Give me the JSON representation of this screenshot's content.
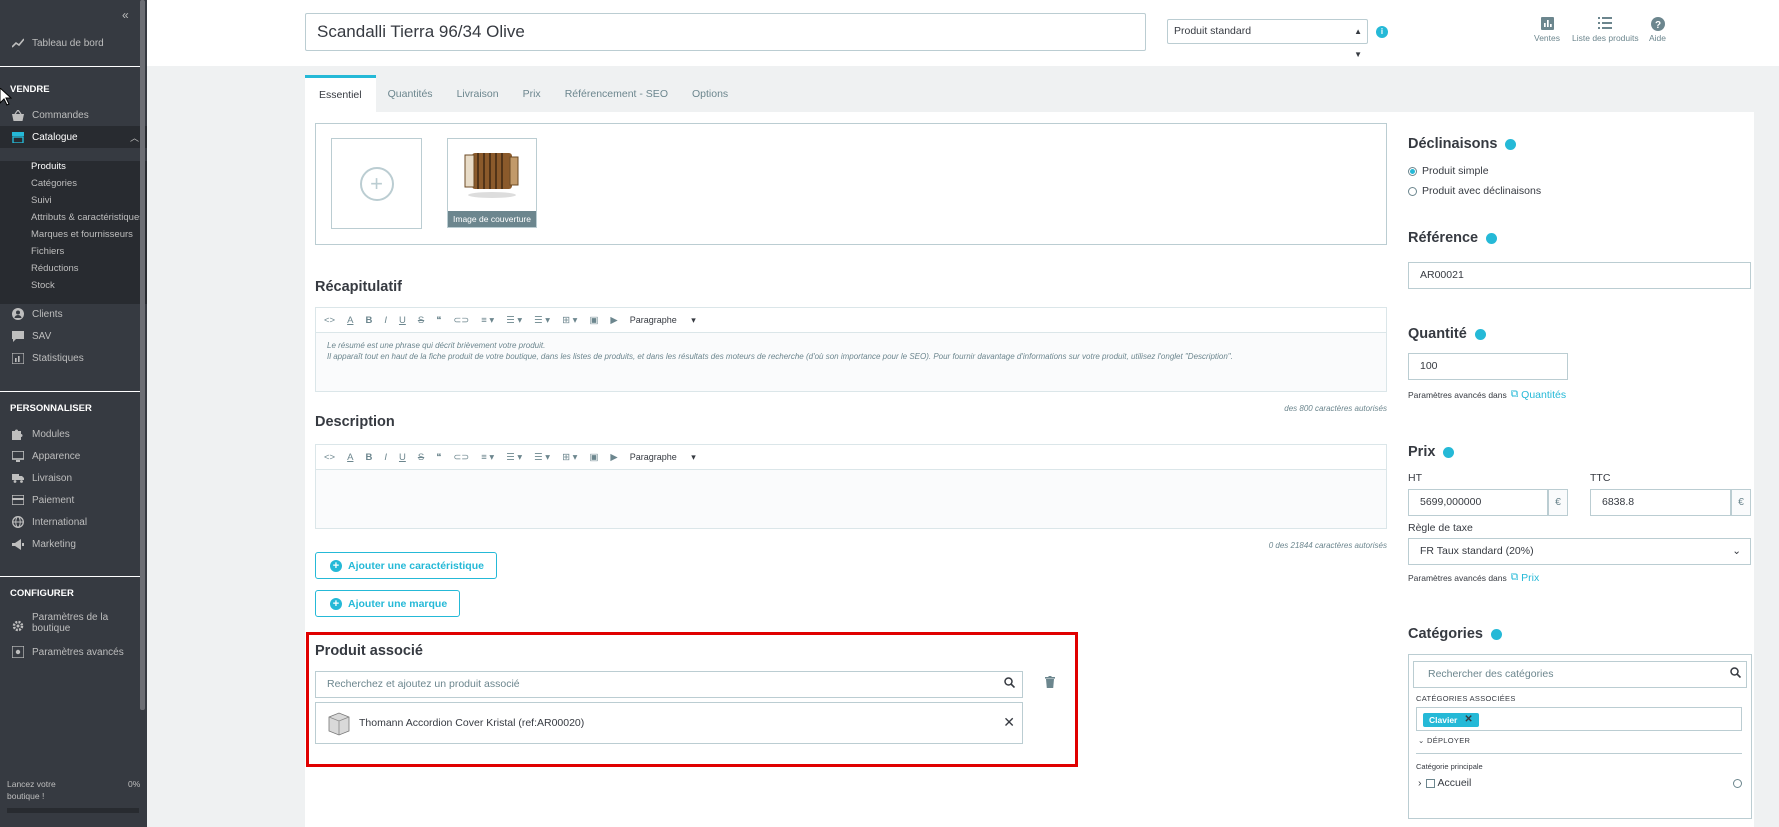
{
  "sidebar": {
    "dashboard": "Tableau de bord",
    "sections": {
      "sell": "VENDRE",
      "customize": "PERSONNALISER",
      "configure": "CONFIGURER"
    },
    "sell_items": {
      "orders": "Commandes",
      "catalog": "Catalogue",
      "customers": "Clients",
      "service": "SAV",
      "stats": "Statistiques"
    },
    "catalog_sub": [
      "Produits",
      "Catégories",
      "Suivi",
      "Attributs & caractéristiques",
      "Marques et fournisseurs",
      "Fichiers",
      "Réductions",
      "Stock"
    ],
    "customize_items": [
      "Modules",
      "Apparence",
      "Livraison",
      "Paiement",
      "International",
      "Marketing"
    ],
    "configure_items": [
      "Paramètres de la boutique",
      "Paramètres avancés"
    ],
    "footer": {
      "line1": "Lancez votre",
      "line2": "boutique !",
      "percent": "0%",
      "progress": 0
    }
  },
  "header": {
    "product_name": "Scandalli Tierra 96/34 Olive",
    "product_type": "Produit standard",
    "actions": {
      "sales": "Ventes",
      "product_list": "Liste des produits",
      "help": "Aide"
    }
  },
  "tabs": [
    "Essentiel",
    "Quantités",
    "Livraison",
    "Prix",
    "Référencement - SEO",
    "Options"
  ],
  "images": {
    "cover_label": "Image de couverture"
  },
  "summary": {
    "title": "Récapitulatif",
    "format_label": "Paragraphe",
    "placeholder_line1": "Le résumé est une phrase qui décrit brièvement votre produit.",
    "placeholder_line2": "Il apparaît tout en haut de la fiche produit de votre boutique, dans les listes de produits, et dans les résultats des moteurs de recherche (d'où son importance pour le SEO). Pour fournir davantage d'informations sur votre produit, utilisez l'onglet \"Description\".",
    "counter": "des 800 caractères autorisés"
  },
  "description": {
    "title": "Description",
    "format_label": "Paragraphe",
    "counter": "0 des 21844 caractères autorisés"
  },
  "buttons": {
    "add_feature": "Ajouter une caractéristique",
    "add_brand": "Ajouter une marque"
  },
  "related": {
    "title": "Produit associé",
    "search_placeholder": "Recherchez et ajoutez un produit associé",
    "item": "Thomann Accordion Cover Kristal (ref:AR00020)"
  },
  "right": {
    "combinations": {
      "title": "Déclinaisons",
      "simple": "Produit simple",
      "with_combinations": "Produit avec déclinaisons"
    },
    "reference": {
      "title": "Référence",
      "value": "AR00021"
    },
    "quantity": {
      "title": "Quantité",
      "value": "100",
      "advanced_prefix": "Paramètres avancés dans",
      "advanced_link": "Quantités"
    },
    "price": {
      "title": "Prix",
      "ht_label": "HT",
      "ttc_label": "TTC",
      "ht_value": "5699,000000",
      "ttc_value": "6838.8",
      "currency": "€",
      "tax_label": "Règle de taxe",
      "tax_value": "FR Taux standard (20%)",
      "advanced_prefix": "Paramètres avancés dans",
      "advanced_link": "Prix"
    },
    "categories": {
      "title": "Catégories",
      "search_placeholder": "Rechercher des catégories",
      "associated_label": "CATÉGORIES ASSOCIÉES",
      "tag": "Clavier",
      "expand": "DÉPLOYER",
      "main_label": "Catégorie principale",
      "tree_item": "Accueil"
    }
  },
  "colors": {
    "accent": "#25b9d7",
    "sidebar": "#363a41",
    "highlight": "#e00000"
  }
}
